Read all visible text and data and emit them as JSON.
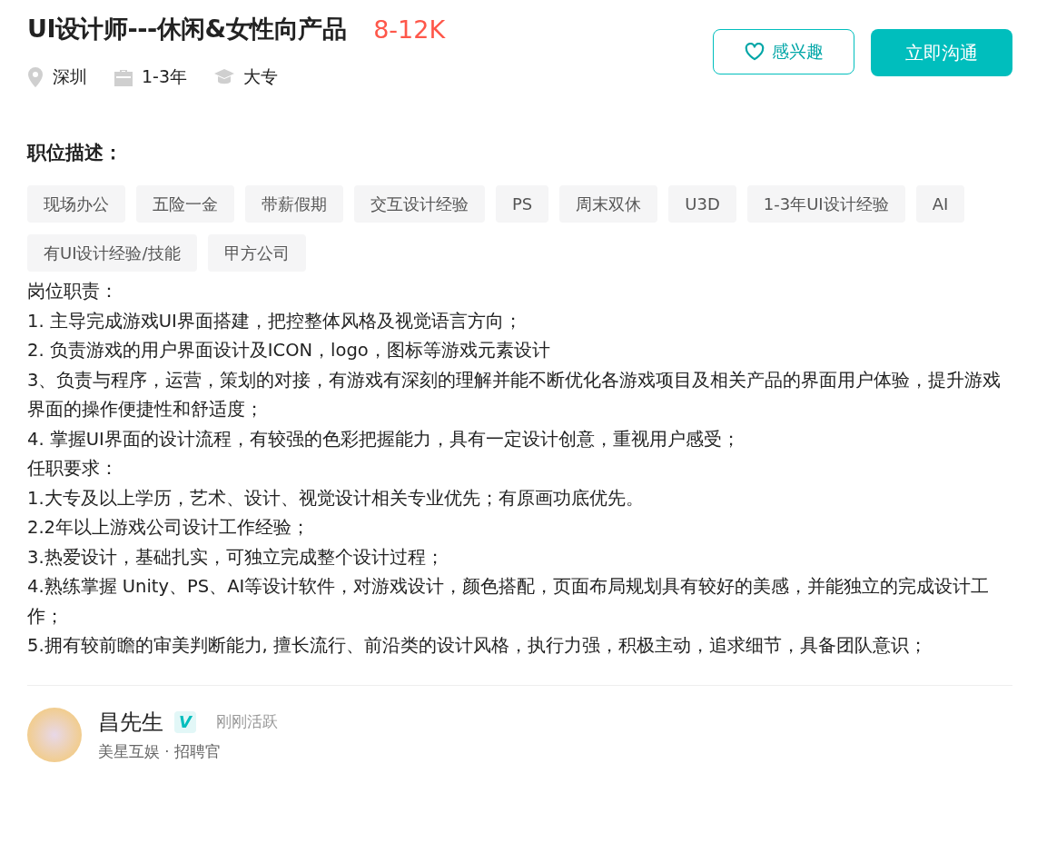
{
  "job": {
    "title": "UI设计师---休闲&女性向产品",
    "salary": "8-12K",
    "meta": [
      {
        "kind": "location",
        "text": "深圳"
      },
      {
        "kind": "experience",
        "text": "1-3年"
      },
      {
        "kind": "education",
        "text": "大专"
      }
    ]
  },
  "buttons": {
    "interest": "感兴趣",
    "chat": "立即沟通"
  },
  "section_title": "职位描述：",
  "tags": [
    "现场办公",
    "五险一金",
    "带薪假期",
    "交互设计经验",
    "PS",
    "周末双休",
    "U3D",
    "1-3年UI设计经验",
    "AI",
    "有UI设计经验/技能",
    "甲方公司"
  ],
  "description": [
    "岗位职责：",
    "1. 主导完成游戏UI界面搭建，把控整体风格及视觉语言方向；",
    "2. 负责游戏的用户界面设计及ICON，logo，图标等游戏元素设计",
    "3、负责与程序，运营，策划的对接，有游戏有深刻的理解并能不断优化各游戏项目及相关产品的界面用户体验，提升游戏界面的操作便捷性和舒适度；",
    "4. 掌握UI界面的设计流程，有较强的色彩把握能力，具有一定设计创意，重视用户感受；",
    "任职要求：",
    "1.大专及以上学历，艺术、设计、视觉设计相关专业优先；有原画功底优先。",
    "2.2年以上游戏公司设计工作经验；",
    "3.热爱设计，基础扎实，可独立完成整个设计过程；",
    "4.熟练掌握 Unity、PS、AI等设计软件，对游戏设计，颜色搭配，页面布局规划具有较好的美感，并能独立的完成设计工作；",
    "5.拥有较前瞻的审美判断能力, 擅长流行、前沿类的设计风格，执行力强，积极主动，追求细节，具备团队意识；"
  ],
  "recruiter": {
    "name": "昌先生",
    "verified": true,
    "badge": "V",
    "status": "刚刚活跃",
    "company": "美星互娱 · 招聘官"
  }
}
